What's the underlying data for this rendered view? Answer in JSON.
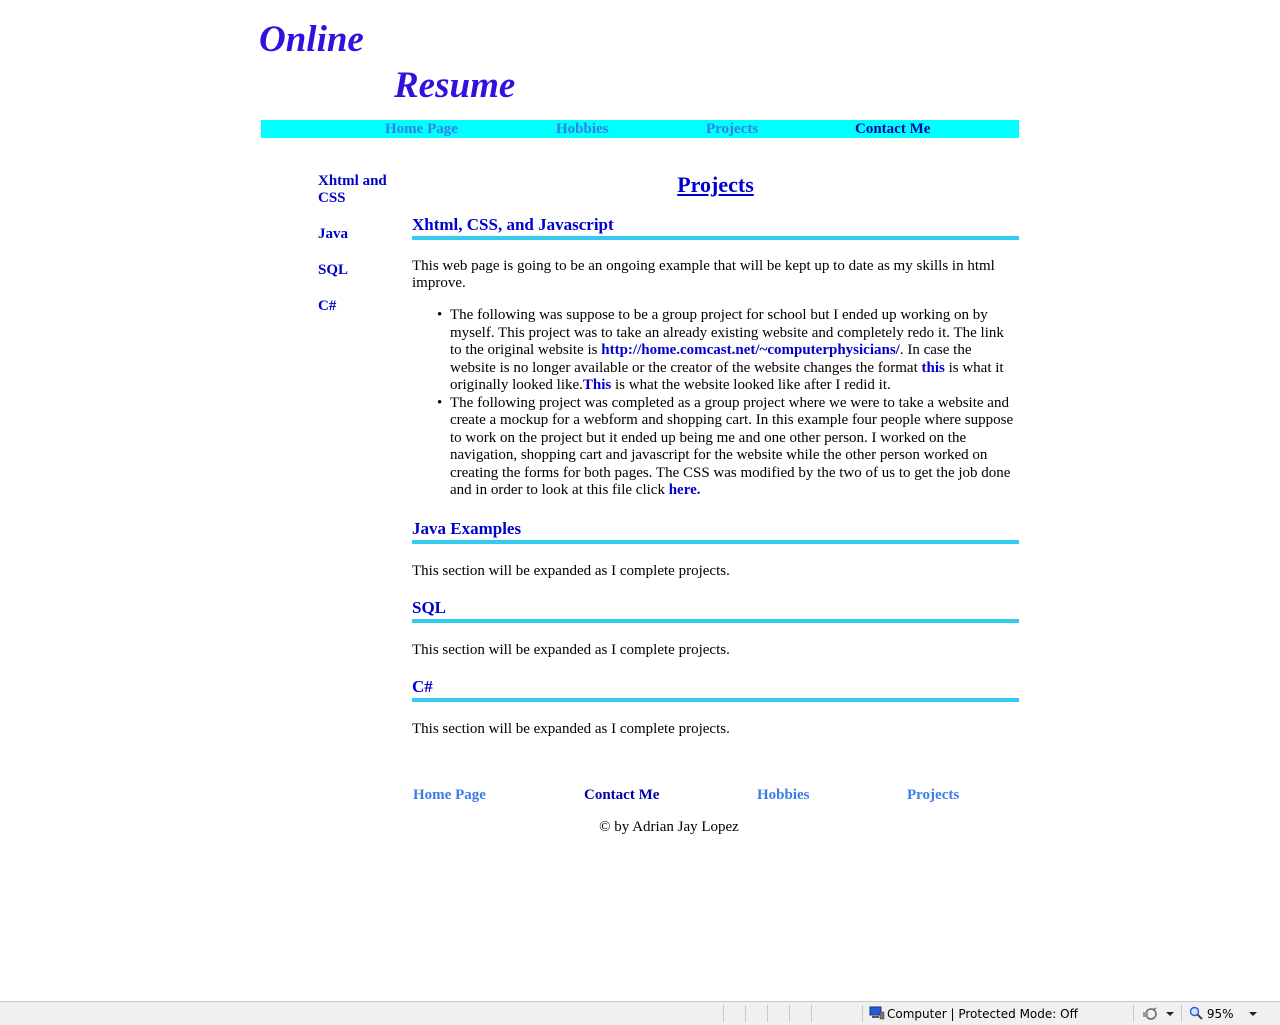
{
  "logo": {
    "line1": "Online",
    "line2": "Resume"
  },
  "top_nav": {
    "home": "Home Page",
    "hobbies": "Hobbies",
    "projects": "Projects",
    "contact": "Contact Me"
  },
  "side_nav": {
    "items": [
      "Xhtml and CSS",
      "Java",
      "SQL",
      "C#"
    ]
  },
  "main": {
    "title": "Projects",
    "sections": [
      {
        "heading": "Xhtml, CSS, and Javascript",
        "intro": "This web page is going to be an ongoing example that will be kept up to date as my skills in html improve.",
        "items": [
          {
            "text1": "The following was suppose to be a group project for school but I ended up working on by myself. This project was to take an already existing website and completely redo it. The link to the original website is ",
            "link1": "http://home.comcast.net/~computerphysicians/",
            "text2": ". In case the website is no longer available or the creator of the website changes the format ",
            "link2": "this",
            "text3": " is what it originally looked like.",
            "link3": "This",
            "text4": " is what the website looked like after I redid it."
          },
          {
            "text1": "The following project was completed as a group project where we were to take a website and create a mockup for a webform and shopping cart. In this example four people where suppose to work on the project but it ended up being me and one other person. I worked on the navigation, shopping cart and javascript for the website while the other person worked on creating the forms for both pages. The CSS was modified by the two of us to get the job done and in order to look at this file click ",
            "link1": "here."
          }
        ]
      },
      {
        "heading": "Java Examples",
        "text": "This section will be expanded as I complete projects."
      },
      {
        "heading": "SQL",
        "text": "This section will be expanded as I complete projects."
      },
      {
        "heading": "C#",
        "text": "This section will be expanded as I complete projects."
      }
    ]
  },
  "footer": {
    "home": "Home Page",
    "contact": "Contact Me",
    "hobbies": "Hobbies",
    "projects": "Projects",
    "copyright": "© by Adrian Jay Lopez"
  },
  "status_bar": {
    "zone_text": "Computer | Protected Mode: Off",
    "zoom": "95%"
  },
  "colors": {
    "logo": "#3311dd",
    "nav_bar": "#00ffff",
    "link_dark": "#0000cc",
    "link_light": "#3a7de6",
    "section_rule": "#33ccee"
  }
}
